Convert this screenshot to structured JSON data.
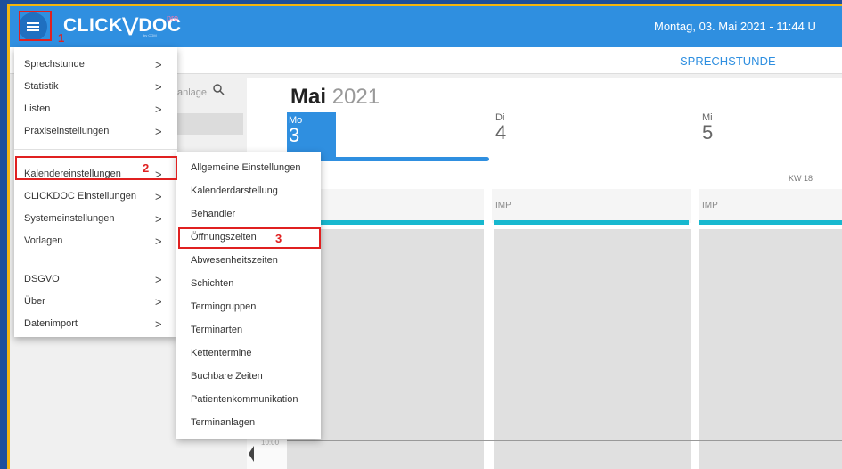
{
  "header": {
    "logo_text": "CLICK⋁DOC",
    "logo_suffix": "pro",
    "logo_by": "by CGM",
    "datetime": "Montag, 03. Mai 2021 - 11:44 U"
  },
  "subbar": {
    "title": "SPRECHSTUNDE"
  },
  "left": {
    "search_fragment": "anlage"
  },
  "calendar": {
    "month": "Mai",
    "year": "2021",
    "week": "KW 18",
    "days": [
      {
        "name": "Mo",
        "num": "3"
      },
      {
        "name": "Di",
        "num": "4"
      },
      {
        "name": "Mi",
        "num": "5"
      }
    ],
    "columns": [
      "",
      "IMP",
      "IMP"
    ],
    "time_label": "10:00"
  },
  "menu": {
    "items": [
      "Sprechstunde",
      "Statistik",
      "Listen",
      "Praxiseinstellungen",
      "Kalendereinstellungen",
      "CLICKDOC Einstellungen",
      "Systemeinstellungen",
      "Vorlagen",
      "DSGVO",
      "Über",
      "Datenimport"
    ],
    "chevron": ">"
  },
  "submenu": {
    "items": [
      "Allgemeine Einstellungen",
      "Kalenderdarstellung",
      "Behandler",
      "Öffnungszeiten",
      "Abwesenheitszeiten",
      "Schichten",
      "Termingruppen",
      "Terminarten",
      "Kettentermine",
      "Buchbare Zeiten",
      "Patientenkommunikation",
      "Terminanlagen"
    ]
  },
  "annotations": {
    "step1": "1",
    "step2": "2",
    "step3": "3"
  },
  "colors": {
    "topbar": "#2f8fe0",
    "accent_teal": "#17b8cf",
    "annotation_red": "#e02020",
    "outer_frame": "#f3b50f",
    "page_border": "#1d4f9c"
  },
  "icons": {
    "menu": "hamburger-icon",
    "search": "search-icon",
    "chevron": "chevron-right-icon",
    "back": "arrow-left-icon"
  }
}
